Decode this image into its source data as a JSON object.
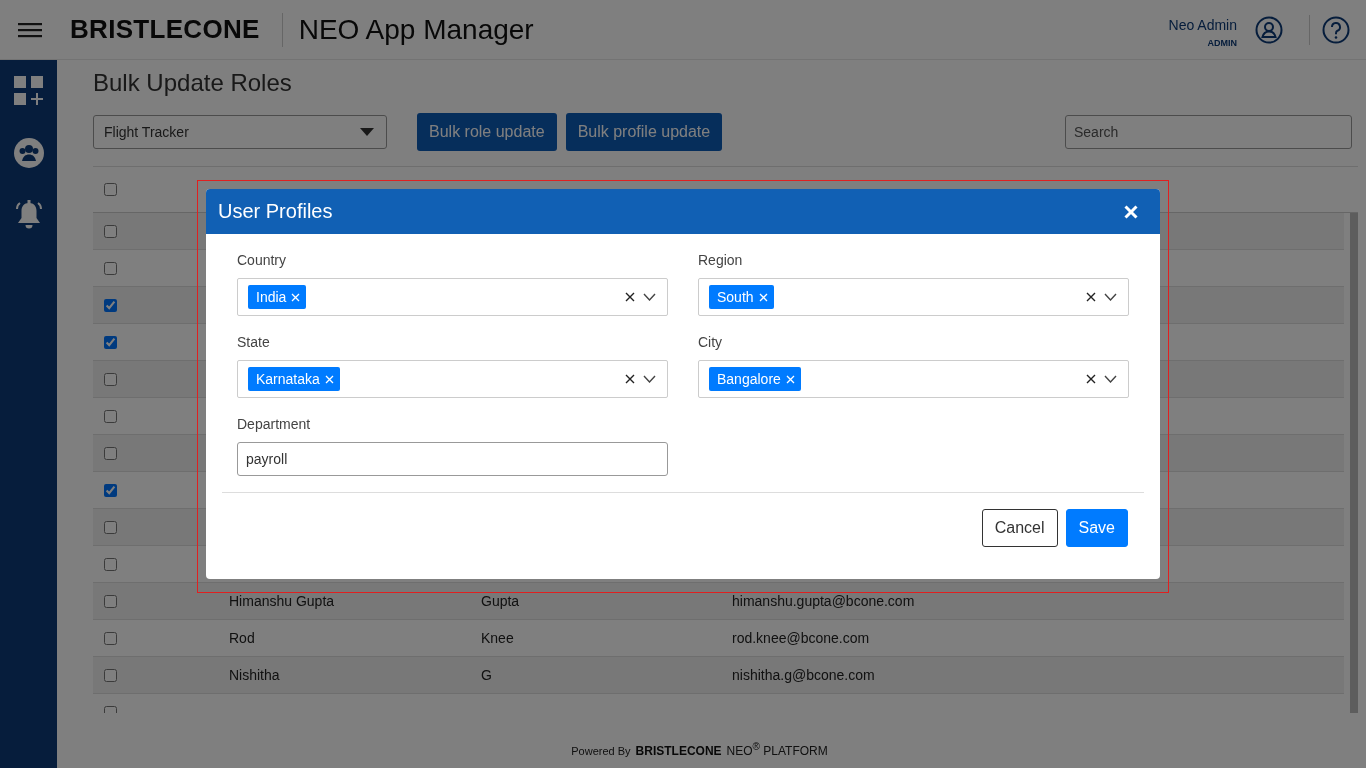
{
  "header": {
    "brand": "BRISTLECONE",
    "app_title": "NEO App Manager",
    "user": {
      "name": "Neo Admin",
      "role": "ADMIN"
    }
  },
  "sidebar": {
    "items": [
      {
        "kind": "apps"
      },
      {
        "kind": "users"
      },
      {
        "kind": "alerts"
      }
    ]
  },
  "page": {
    "title": "Bulk Update Roles",
    "app_select": {
      "value": "Flight Tracker"
    },
    "buttons": [
      "Bulk role update",
      "Bulk profile update"
    ],
    "search": {
      "placeholder": "Search"
    }
  },
  "table": {
    "header_checked": false,
    "rows": [
      {
        "checked": false
      },
      {
        "checked": false
      },
      {
        "checked": true
      },
      {
        "checked": true
      },
      {
        "checked": false
      },
      {
        "checked": false
      },
      {
        "checked": false
      },
      {
        "checked": true
      },
      {
        "checked": false
      },
      {
        "checked": false
      },
      {
        "checked": false,
        "first_name": "Himanshu Gupta",
        "last_name": "Gupta",
        "email": "himanshu.gupta@bcone.com"
      },
      {
        "checked": false,
        "first_name": "Rod",
        "last_name": "Knee",
        "email": "rod.knee@bcone.com"
      },
      {
        "checked": false,
        "first_name": "Nishitha",
        "last_name": "G",
        "email": "nishitha.g@bcone.com"
      },
      {
        "checked": false
      }
    ]
  },
  "footer": {
    "powered_by": "Powered By",
    "brand": "BRISTLECONE",
    "platform": "NEO$^{®}$ PLATFORM"
  },
  "dialog": {
    "title": "User Profiles",
    "fields": [
      {
        "label": "Country",
        "kind": "multiselect",
        "tags": [
          "India"
        ]
      },
      {
        "label": "Region",
        "kind": "multiselect",
        "tags": [
          "South"
        ]
      },
      {
        "label": "State",
        "kind": "multiselect",
        "tags": [
          "Karnataka"
        ]
      },
      {
        "label": "City",
        "kind": "multiselect",
        "tags": [
          "Bangalore"
        ]
      },
      {
        "label": "Department",
        "kind": "text",
        "value": "payroll"
      }
    ],
    "buttons": [
      {
        "label": "Cancel",
        "kind": "secondary"
      },
      {
        "label": "Save",
        "kind": "primary"
      }
    ]
  }
}
